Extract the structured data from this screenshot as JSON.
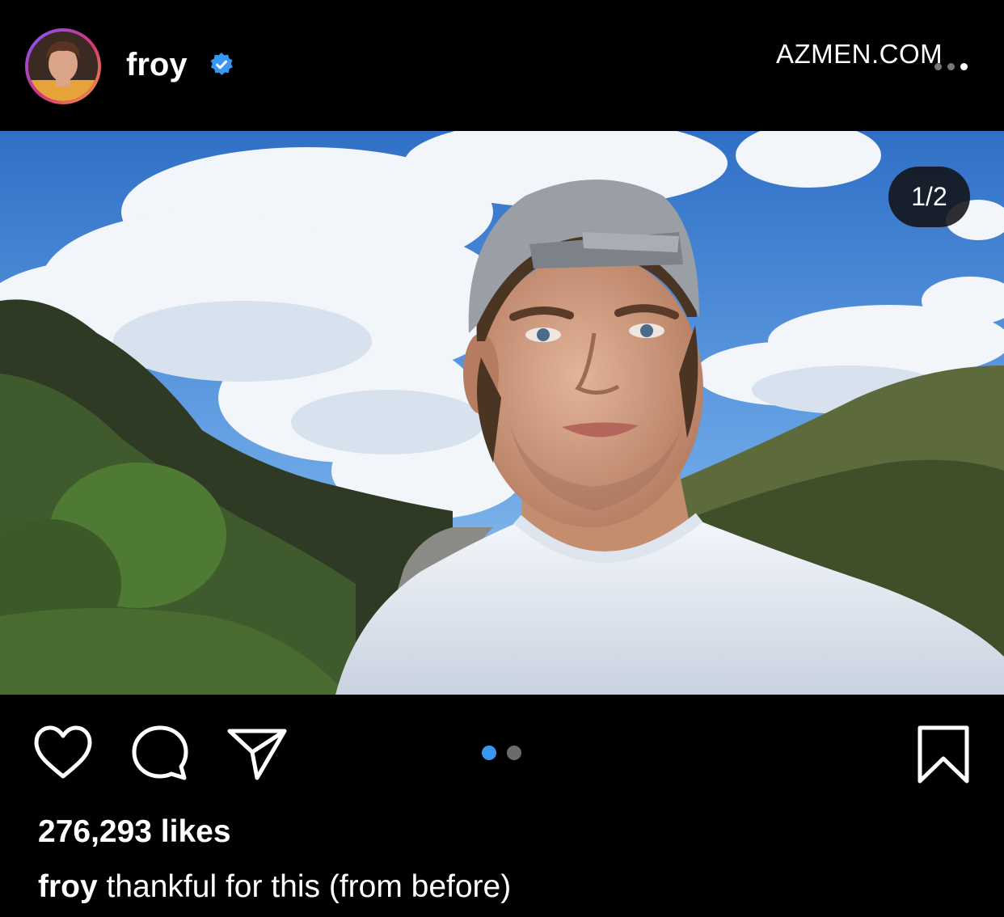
{
  "post": {
    "username": "froy",
    "verified": true,
    "watermark": "AZMEN.COM",
    "image_counter": "1/2",
    "likes": "276,293 likes",
    "caption_user": "froy",
    "caption_text": " thankful for this (from before)"
  },
  "carousel": {
    "total": 2,
    "active_index": 0,
    "active_color": "#3897f0",
    "inactive_color": "#6b6b6b"
  },
  "icons": {
    "like": "heart-icon",
    "comment": "comment-bubble-icon",
    "share": "send-paper-plane-icon",
    "save": "bookmark-icon",
    "more": "more-options-icon",
    "verified": "verified-badge-icon"
  },
  "colors": {
    "background": "#000000",
    "verified_blue": "#3897f0",
    "text": "#ffffff"
  }
}
